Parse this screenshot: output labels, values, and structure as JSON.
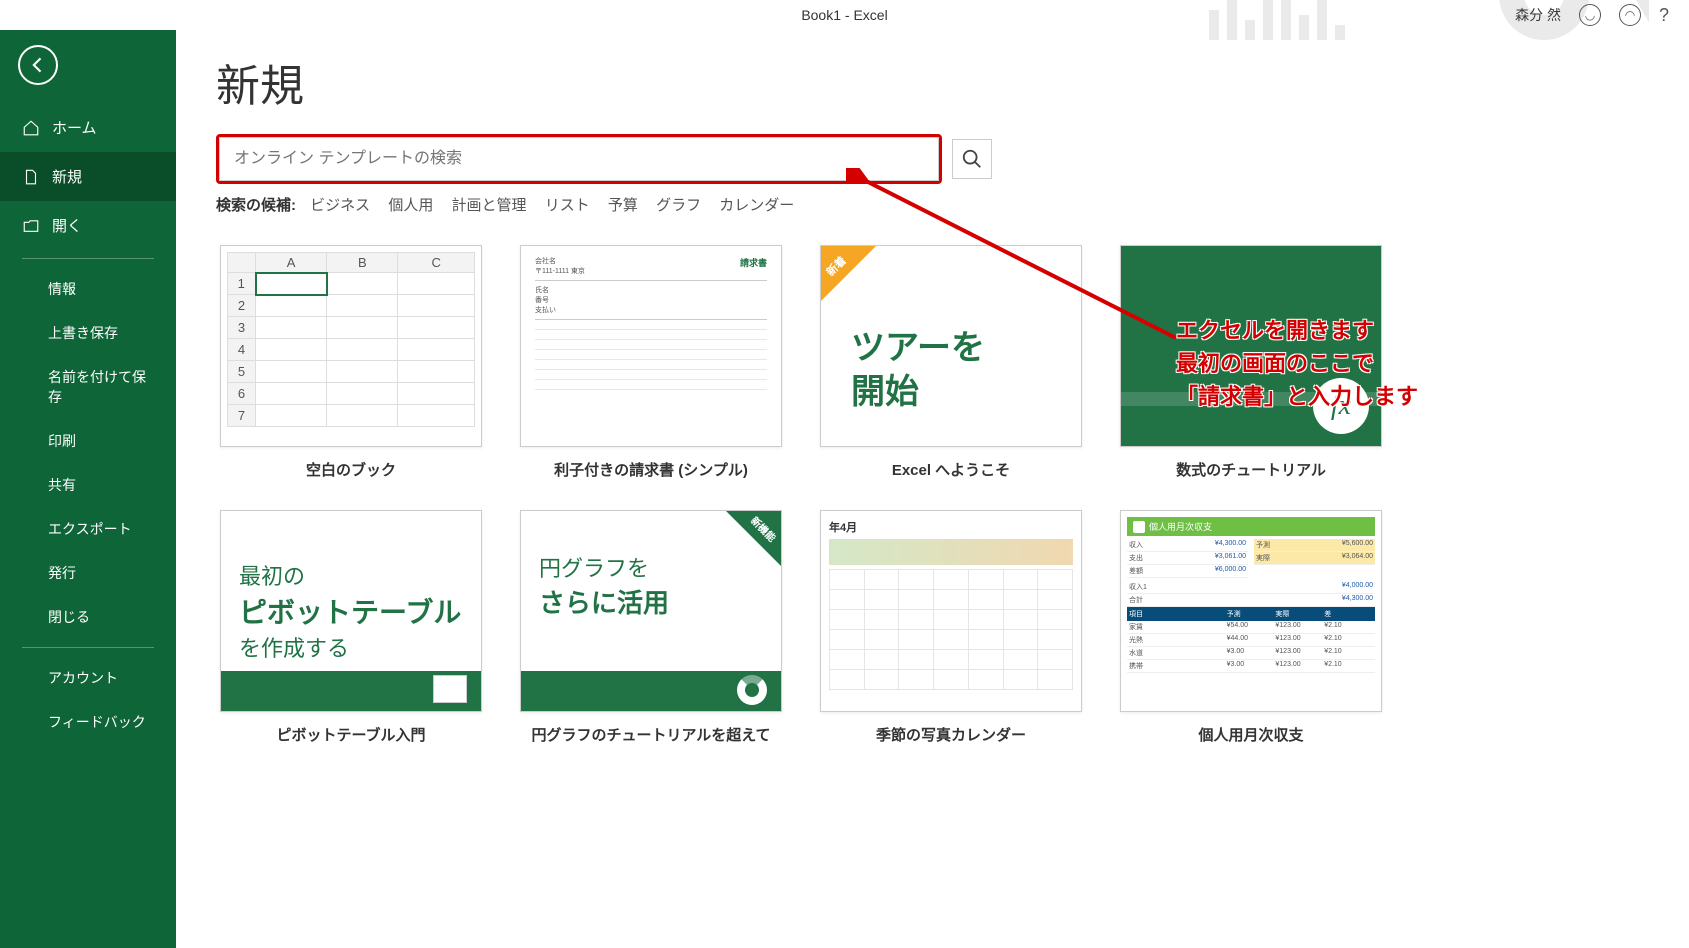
{
  "titlebar": {
    "title": "Book1  -  Excel",
    "user": "森分 然"
  },
  "sidebar": {
    "home": "ホーム",
    "new": "新規",
    "open": "開く",
    "info": "情報",
    "save": "上書き保存",
    "saveas": "名前を付けて保存",
    "print": "印刷",
    "share": "共有",
    "export": "エクスポート",
    "publish": "発行",
    "close": "閉じる",
    "account": "アカウント",
    "feedback": "フィードバック"
  },
  "main": {
    "title": "新規",
    "search_placeholder": "オンライン テンプレートの検索",
    "suggest_label": "検索の候補:",
    "suggest": [
      "ビジネス",
      "個人用",
      "計画と管理",
      "リスト",
      "予算",
      "グラフ",
      "カレンダー"
    ]
  },
  "templates": [
    {
      "label": "空白のブック"
    },
    {
      "label": "利子付きの請求書 (シンプル)",
      "thumb_title": "請求書"
    },
    {
      "label": "Excel へようこそ",
      "badge": "新着",
      "thumb_line1": "ツアーを",
      "thumb_line2": "開始"
    },
    {
      "label": "数式のチュートリアル",
      "fx": "fx"
    },
    {
      "label": "ピボットテーブル入門",
      "thumb_pre": "最初の",
      "thumb_big": "ピボットテーブル",
      "thumb_post": "を作成する"
    },
    {
      "label": "円グラフのチュートリアルを超えて",
      "badge": "新機能",
      "thumb_pre": "円グラフを",
      "thumb_big": "さらに活用"
    },
    {
      "label": "季節の写真カレンダー",
      "month": "年4月"
    },
    {
      "label": "個人用月次収支",
      "thumb_title": "個人用月次収支"
    }
  ],
  "annotation": {
    "line1": "エクセルを開きます",
    "line2": "最初の画面のここで",
    "line3": "「請求書」と入力します"
  }
}
